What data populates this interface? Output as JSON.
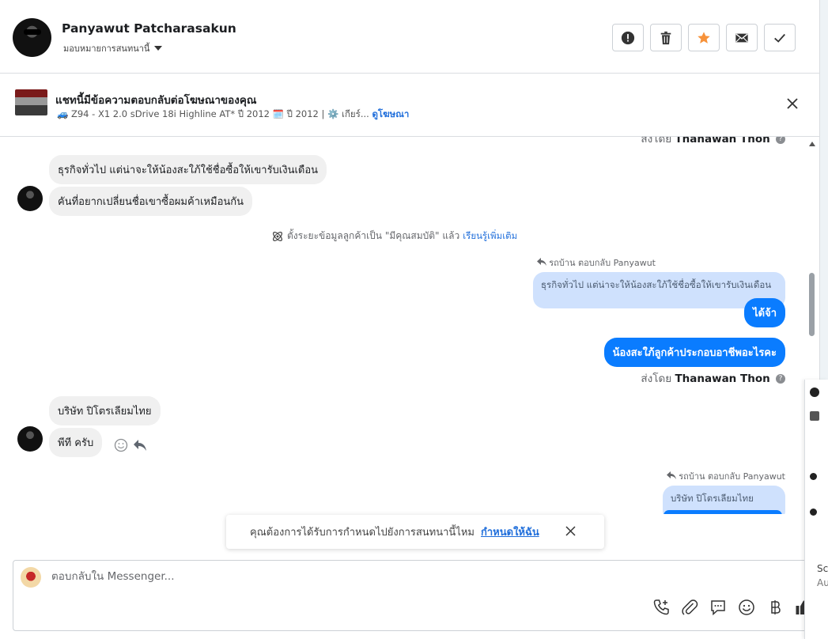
{
  "header": {
    "name": "Panyawut Patcharasakun",
    "assign_label": "มอบหมายการสนทนานี้"
  },
  "ad": {
    "title": "แชทนี้มีข้อความตอบกลับต่อโฆษณาของคุณ",
    "info": "🚙 Z94 - X1 2.0 sDrive 18i Highline AT* ปี 2012 🗓️ ปี 2012 | ⚙️ เกียร์...",
    "view_ad": "ดูโฆษณา"
  },
  "messages": {
    "top_partial_sent_by": "ส่งโดย",
    "top_partial_sender": "Thanawan Thon",
    "in1": "ธุรกิจทั่วไป แต่น่าจะให้น้องสะใภ้ใช้ชื่อซื้อให้เขารับเงินเดือน",
    "in2": "คันที่อยากเปลี่ยนชื่อเขาซื้อผมค้าเหมือนกัน",
    "system_text": "ตั้งระยะข้อมูลลูกค้าเป็น \"มีคุณสมบัติ\" แล้ว",
    "system_link": "เรียนรู้เพิ่มเติม",
    "reply_meta1": "รถบ้าน ตอบกลับ Panyawut",
    "quote1": "ธุรกิจทั่วไป แต่น่าจะให้น้องสะใภ้ใช้ชื่อซื้อให้เขารับเงินเดือน",
    "out1": "ได้จ้า",
    "out2": "น้องสะใภ้ลูกค้าประกอบอาชีพอะไรคะ",
    "sent_by_label": "ส่งโดย",
    "sent_by_name": "Thanawan Thon",
    "in3": "บริษัท ปิโตรเลียมไทย",
    "in4": "พีที ครับ",
    "reply_meta2": "รถบ้าน ตอบกลับ Panyawut",
    "quote2": "บริษัท ปิโตรเลียมไทย"
  },
  "toast": {
    "text": "คุณต้องการได้รับการกำหนดไปยังการสนทนานี้ไหม",
    "link": "กำหนดให้ฉัน"
  },
  "composer": {
    "placeholder": "ตอบกลับใน Messenger..."
  },
  "side": {
    "label_sc": "Sc",
    "label_au": "Au"
  },
  "colors": {
    "accent": "#0a7cff",
    "star": "#f7923a"
  }
}
